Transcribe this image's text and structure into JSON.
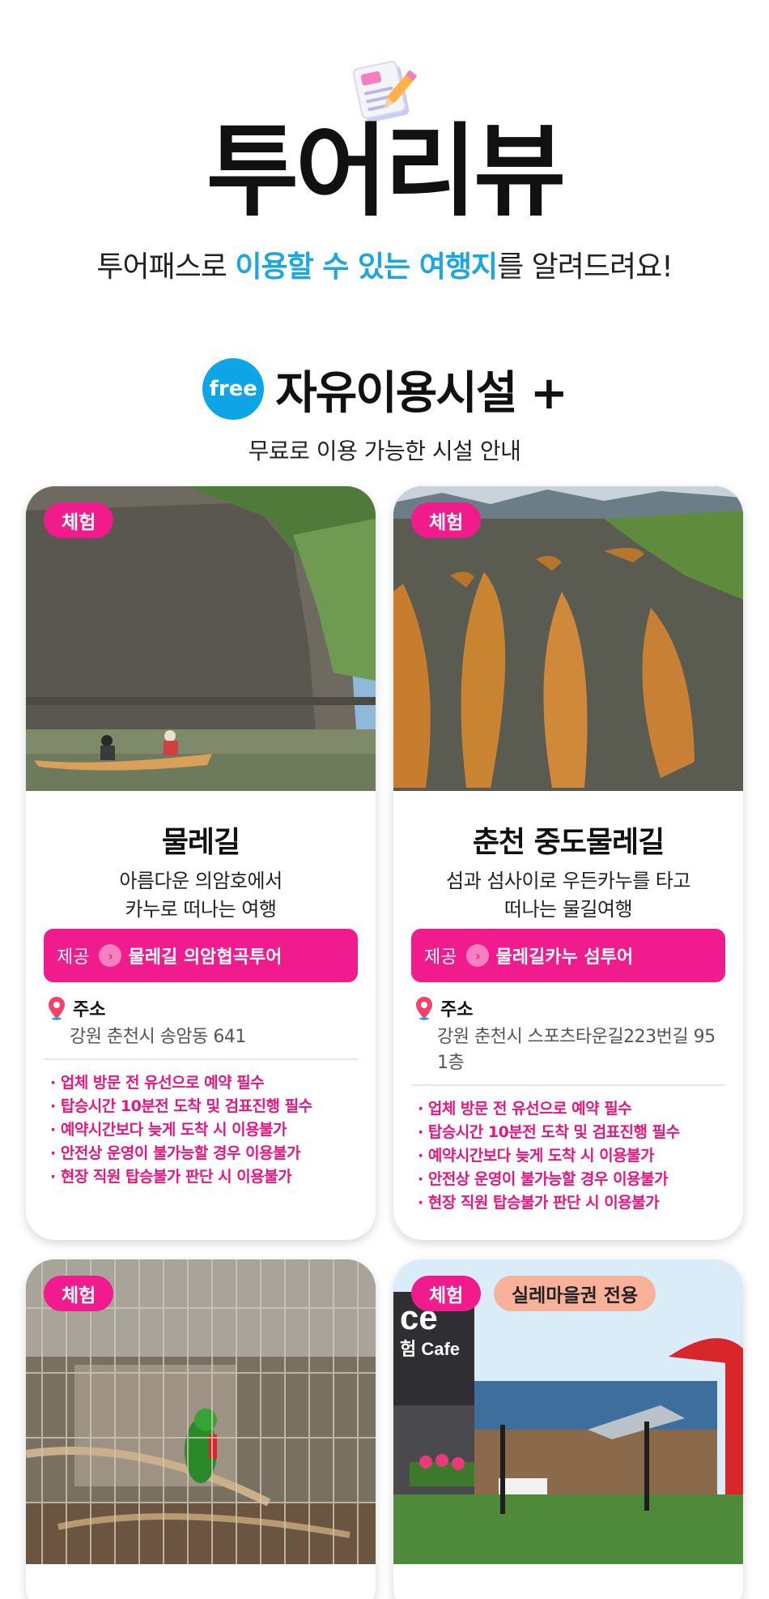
{
  "hero": {
    "icon": "memo-pencil-icon",
    "title": "투어리뷰",
    "subtitle_parts": [
      "투어패스로 ",
      "이용할 수 있는 여행지",
      "를 알려드려요!"
    ]
  },
  "section": {
    "badge": "free",
    "title": "자유이용시설 +",
    "subtitle": "무료로 이용 가능한 시설 안내"
  },
  "colors": {
    "accent_pink": "#f01b8c",
    "accent_blue": "#1aa6de",
    "tag_peach": "#f9b29a"
  },
  "cards": [
    {
      "tag": "체험",
      "title": "물레길",
      "desc": [
        "아름다운 의암호에서",
        "카누로 떠나는 여행"
      ],
      "provider_label": "제공",
      "provider_name": "물레길 의암협곡투어",
      "address_label": "주소",
      "address": "강원 춘천시 송암동 641",
      "notes": [
        "업체 방문 전 유선으로 예약 필수",
        "탑승시간 10분전 도착 및 검표진행 필수",
        "예약시간보다 늦게 도착 시 이용불가",
        "안전상 운영이 불가능할 경우 이용불가",
        "현장 직원 탑승불가 판단 시 이용불가"
      ]
    },
    {
      "tag": "체험",
      "title": "춘천 중도물레길",
      "desc": [
        "섬과 섬사이로 우든카누를 타고",
        "떠나는 물길여행"
      ],
      "provider_label": "제공",
      "provider_name": "물레길카누 섬투어",
      "address_label": "주소",
      "address": "강원 춘천시 스포츠타운길223번길 95 1층",
      "notes": [
        "업체 방문 전 유선으로 예약 필수",
        "탑승시간 10분전 도착 및 검표진행 필수",
        "예약시간보다 늦게 도착 시 이용불가",
        "안전상 운영이 불가능할 경우 이용불가",
        "현장 직원 탑승불가 판단 시 이용불가"
      ]
    },
    {
      "tag": "체험"
    },
    {
      "tag": "체험",
      "tag2": "실레마을권 전용",
      "sign_text": "ce",
      "sign_sub": "험 Cafe"
    }
  ]
}
